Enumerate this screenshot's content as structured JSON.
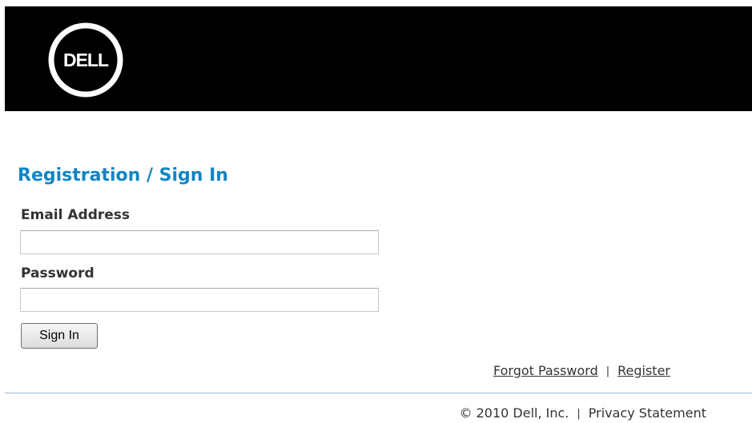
{
  "header": {
    "logo_text": "DELL"
  },
  "form": {
    "title": "Registration / Sign In",
    "email_label": "Email Address",
    "email_value": "",
    "password_label": "Password",
    "password_value": "",
    "sign_in_label": "Sign In"
  },
  "links": {
    "forgot_password": "Forgot Password",
    "separator": "|",
    "register": "Register"
  },
  "footer": {
    "copyright": "© 2010 Dell, Inc.",
    "separator": "|",
    "privacy": "Privacy Statement"
  },
  "colors": {
    "header_bg": "#000000",
    "title": "#0f86c3",
    "divider": "#9ab7db"
  }
}
